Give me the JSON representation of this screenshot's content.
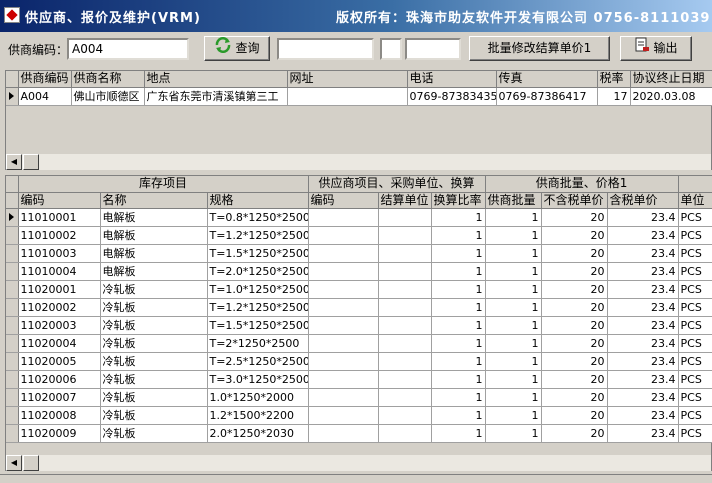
{
  "window": {
    "title": "供应商、报价及维护(VRM)",
    "copyright": "版权所有：珠海市助友软件开发有限公司 0756-8111039"
  },
  "toolbar": {
    "supplier_code_label": "供商编码：",
    "supplier_code_value": "A004",
    "query_label": "查询",
    "filter1_value": "",
    "filter2_value": "",
    "filter3_value": "",
    "batch_button_label": "批量修改结算单价1",
    "export_label": "输出"
  },
  "supplier_table": {
    "headers": [
      "供商编码",
      "供商名称",
      "地点",
      "网址",
      "电话",
      "传真",
      "税率",
      "协议终止日期"
    ],
    "rows": [
      [
        "A004",
        "佛山市顺德区",
        "广东省东莞市清溪镇第三工",
        "",
        "0769-87383435",
        "0769-87386417",
        "17",
        "2020.03.08"
      ]
    ]
  },
  "items_table": {
    "group_headers": [
      "库存项目",
      "供应商项目、采购单位、换算",
      "供商批量、价格1",
      ""
    ],
    "headers": [
      "编码",
      "名称",
      "规格",
      "编码",
      "结算单位",
      "换算比率",
      "供商批量",
      "不含税单价",
      "含税单价",
      "单位"
    ],
    "rows": [
      [
        "11010001",
        "电解板",
        "T=0.8*1250*2500",
        "",
        "",
        "1",
        "1",
        "20",
        "23.4",
        "PCS"
      ],
      [
        "11010002",
        "电解板",
        "T=1.2*1250*2500",
        "",
        "",
        "1",
        "1",
        "20",
        "23.4",
        "PCS"
      ],
      [
        "11010003",
        "电解板",
        "T=1.5*1250*2500",
        "",
        "",
        "1",
        "1",
        "20",
        "23.4",
        "PCS"
      ],
      [
        "11010004",
        "电解板",
        "T=2.0*1250*2500",
        "",
        "",
        "1",
        "1",
        "20",
        "23.4",
        "PCS"
      ],
      [
        "11020001",
        "冷轧板",
        "T=1.0*1250*2500",
        "",
        "",
        "1",
        "1",
        "20",
        "23.4",
        "PCS"
      ],
      [
        "11020002",
        "冷轧板",
        "T=1.2*1250*2500",
        "",
        "",
        "1",
        "1",
        "20",
        "23.4",
        "PCS"
      ],
      [
        "11020003",
        "冷轧板",
        "T=1.5*1250*2500",
        "",
        "",
        "1",
        "1",
        "20",
        "23.4",
        "PCS"
      ],
      [
        "11020004",
        "冷轧板",
        "T=2*1250*2500",
        "",
        "",
        "1",
        "1",
        "20",
        "23.4",
        "PCS"
      ],
      [
        "11020005",
        "冷轧板",
        "T=2.5*1250*2500",
        "",
        "",
        "1",
        "1",
        "20",
        "23.4",
        "PCS"
      ],
      [
        "11020006",
        "冷轧板",
        "T=3.0*1250*2500",
        "",
        "",
        "1",
        "1",
        "20",
        "23.4",
        "PCS"
      ],
      [
        "11020007",
        "冷轧板",
        "1.0*1250*2000",
        "",
        "",
        "1",
        "1",
        "20",
        "23.4",
        "PCS"
      ],
      [
        "11020008",
        "冷轧板",
        "1.2*1500*2200",
        "",
        "",
        "1",
        "1",
        "20",
        "23.4",
        "PCS"
      ],
      [
        "11020009",
        "冷轧板",
        "2.0*1250*2030",
        "",
        "",
        "1",
        "1",
        "20",
        "23.4",
        "PCS"
      ]
    ]
  },
  "icons": {
    "query": "refresh-arrows-icon",
    "export": "export-document-icon",
    "app": "app-icon",
    "row_indicator": "current-row-arrow-icon"
  },
  "colors": {
    "titlebar_start": "#0a246a",
    "titlebar_end": "#a6caf0",
    "query_icon": "#2a9a2a",
    "export_icon": "#c02020"
  }
}
